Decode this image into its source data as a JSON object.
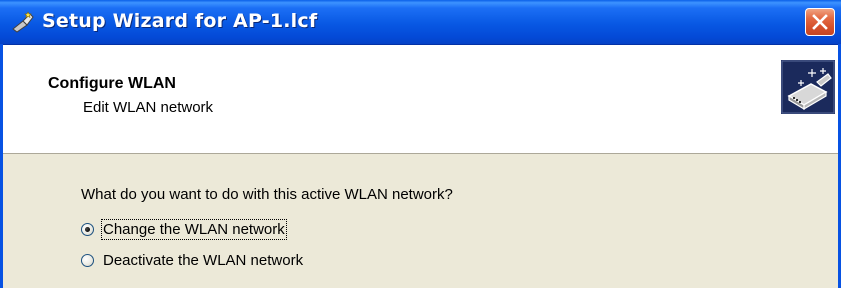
{
  "window": {
    "title": "Setup Wizard for AP-1.lcf",
    "close_label": "Close"
  },
  "header": {
    "heading": "Configure WLAN",
    "subheading": "Edit WLAN network"
  },
  "content": {
    "question": "What do you want to do with this active WLAN network?",
    "options": [
      {
        "label": "Change the WLAN network",
        "selected": true
      },
      {
        "label": "Deactivate the WLAN network",
        "selected": false
      }
    ]
  },
  "icons": {
    "title": "wizard-icon",
    "close": "close-icon",
    "header_graphic": "wizard-device-icon"
  },
  "colors": {
    "titlebar": "#0858E3",
    "close_button": "#D5502A",
    "body_background": "#ECE9D8",
    "header_background": "#FFFFFF"
  }
}
